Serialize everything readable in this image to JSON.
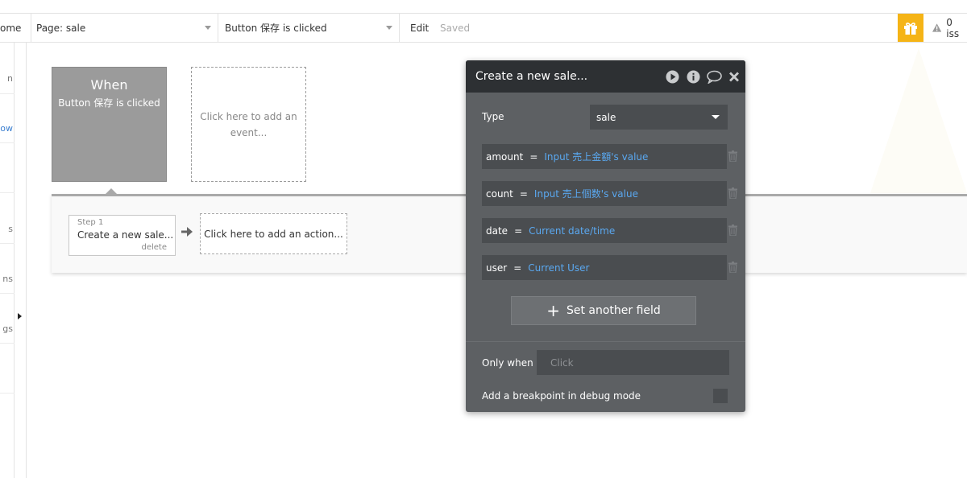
{
  "topbar": {
    "home_label": "ome",
    "page_select": "Page: sale",
    "event_select": "Button 保存 is clicked",
    "edit_label": "Edit",
    "saved_label": "Saved",
    "issues_label": "0 iss"
  },
  "sidebar": {
    "items": [
      "n",
      "ow",
      "s",
      "ns",
      "gs"
    ]
  },
  "events": {
    "when_title": "When",
    "when_sub": "Button 保存 is clicked",
    "add_event": "Click here to add an event..."
  },
  "actions": {
    "step_number": "Step 1",
    "step_title": "Create a new sale...",
    "step_delete": "delete",
    "add_action": "Click here to add an action..."
  },
  "panel": {
    "title": "Create a new sale...",
    "type_label": "Type",
    "type_value": "sale",
    "fields": [
      {
        "name": "amount",
        "eq": "=",
        "value": "Input 売上金額's value"
      },
      {
        "name": "count",
        "eq": "=",
        "value": "Input 売上個数's value"
      },
      {
        "name": "date",
        "eq": "=",
        "value": "Current date/time"
      },
      {
        "name": "user",
        "eq": "=",
        "value": "Current User"
      }
    ],
    "set_field_label": "Set another field",
    "only_when_label": "Only when",
    "only_when_placeholder": "Click",
    "breakpoint_label": "Add a breakpoint in debug mode"
  },
  "colors": {
    "accent_gift": "#f5b416",
    "panel_bg": "#5d6063",
    "panel_header": "#2d3033",
    "value_link": "#5aa8f0",
    "event_box": "#9b9b9b"
  }
}
